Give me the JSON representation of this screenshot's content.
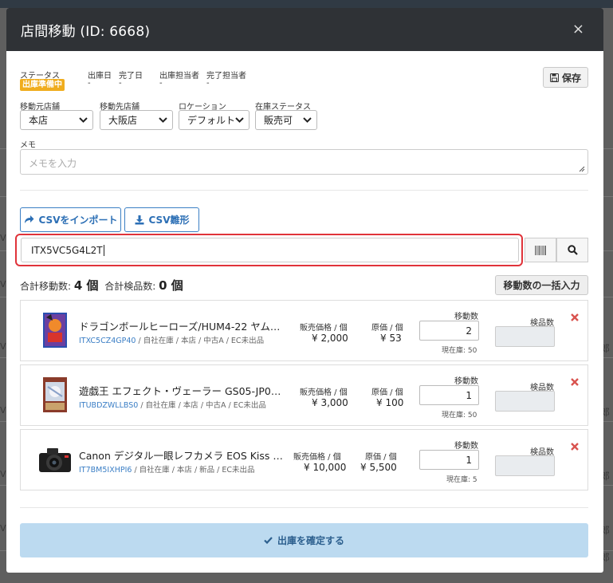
{
  "modal": {
    "title": "店間移動 (ID: 6668)",
    "close_symbol": "×"
  },
  "status": {
    "labels": {
      "status": "ステータス",
      "ship_date": "出庫日",
      "complete_date": "完了日",
      "shipper": "出庫担当者",
      "completer": "完了担当者"
    },
    "badge": "出庫準備中",
    "empty": "-"
  },
  "save_label": "保存",
  "filters": {
    "from_store": {
      "label": "移動元店舗",
      "value": "本店"
    },
    "to_store": {
      "label": "移動先店舗",
      "value": "大阪店"
    },
    "location": {
      "label": "ロケーション",
      "value": "デフォルト"
    },
    "stock_status": {
      "label": "在庫ステータス",
      "value": "販売可"
    }
  },
  "memo": {
    "label": "メモ",
    "placeholder": "メモを入力"
  },
  "csv": {
    "import_label": "CSVをインポート",
    "template_label": "CSV雛形"
  },
  "scan": {
    "value": "ITX5VC5G4L2T"
  },
  "totals": {
    "move_label": "合計移動数:",
    "move_value": "4 個",
    "inspect_label": "合計検品数:",
    "inspect_value": "0 個"
  },
  "bulk_label": "移動数の一括入力",
  "column_labels": {
    "sale_price": "販売価格 / 個",
    "cost": "原価 / 個",
    "quantity": "移動数",
    "inspected": "検品数"
  },
  "items": [
    {
      "name": "ドラゴンボールヒーローズ/HUM4-22 ヤムチャ",
      "code": "ITXC5CZ4GP40",
      "meta": " / 自社在庫 / 本店 / 中古A / EC未出品",
      "sale_price": "¥ 2,000",
      "cost": "¥ 53",
      "quantity": "2",
      "stock": "現在庫: 50"
    },
    {
      "name": "遊戯王 エフェクト・ヴェーラー GS05-JP008 ノーマ...",
      "code": "ITUBDZWLLBS0",
      "meta": " / 自社在庫 / 本店 / 中古A / EC未出品",
      "sale_price": "¥ 3,000",
      "cost": "¥ 100",
      "quantity": "1",
      "stock": "現在庫: 50"
    },
    {
      "name": "Canon デジタル一眼レフカメラ EOS Kiss X90...",
      "code": "IT7BM5IXHPI6",
      "meta": " / 自社在庫 / 本店 / 新品 / EC未出品",
      "sale_price": "¥ 10,000",
      "cost": "¥ 5,500",
      "quantity": "1",
      "stock": "現在庫: 5"
    }
  ],
  "confirm_label": "出庫を確定する",
  "background": {
    "right_glyph": "郎",
    "left_glyph": "V"
  },
  "colors": {
    "header": "#2f3236",
    "badge": "#f0ad1e",
    "accent": "#3b7fc4",
    "scan_highlight": "#e0333a",
    "delete": "#d9534f",
    "confirm_bg": "#bcdaf0"
  }
}
